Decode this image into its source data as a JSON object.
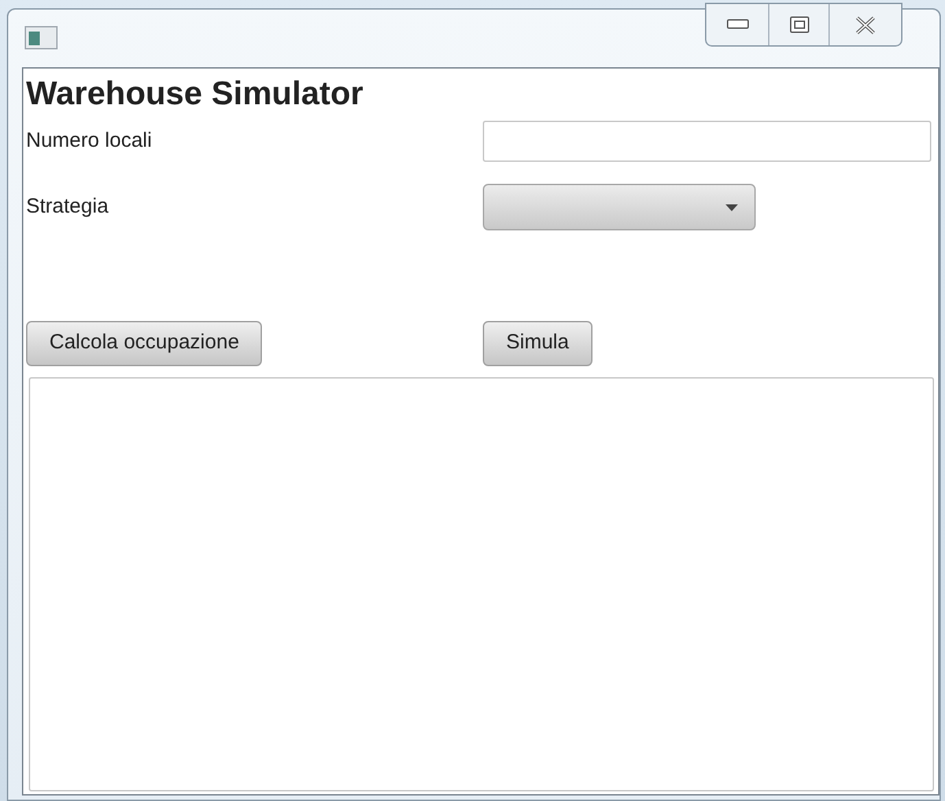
{
  "title": "Warehouse Simulator",
  "fields": [
    {
      "label": "Numero locali",
      "kind": "text"
    },
    {
      "label": "Strategia",
      "kind": "combo"
    }
  ],
  "buttons": [
    "Calcola occupazione",
    "Simula"
  ],
  "output": {
    "kind": "textarea"
  }
}
